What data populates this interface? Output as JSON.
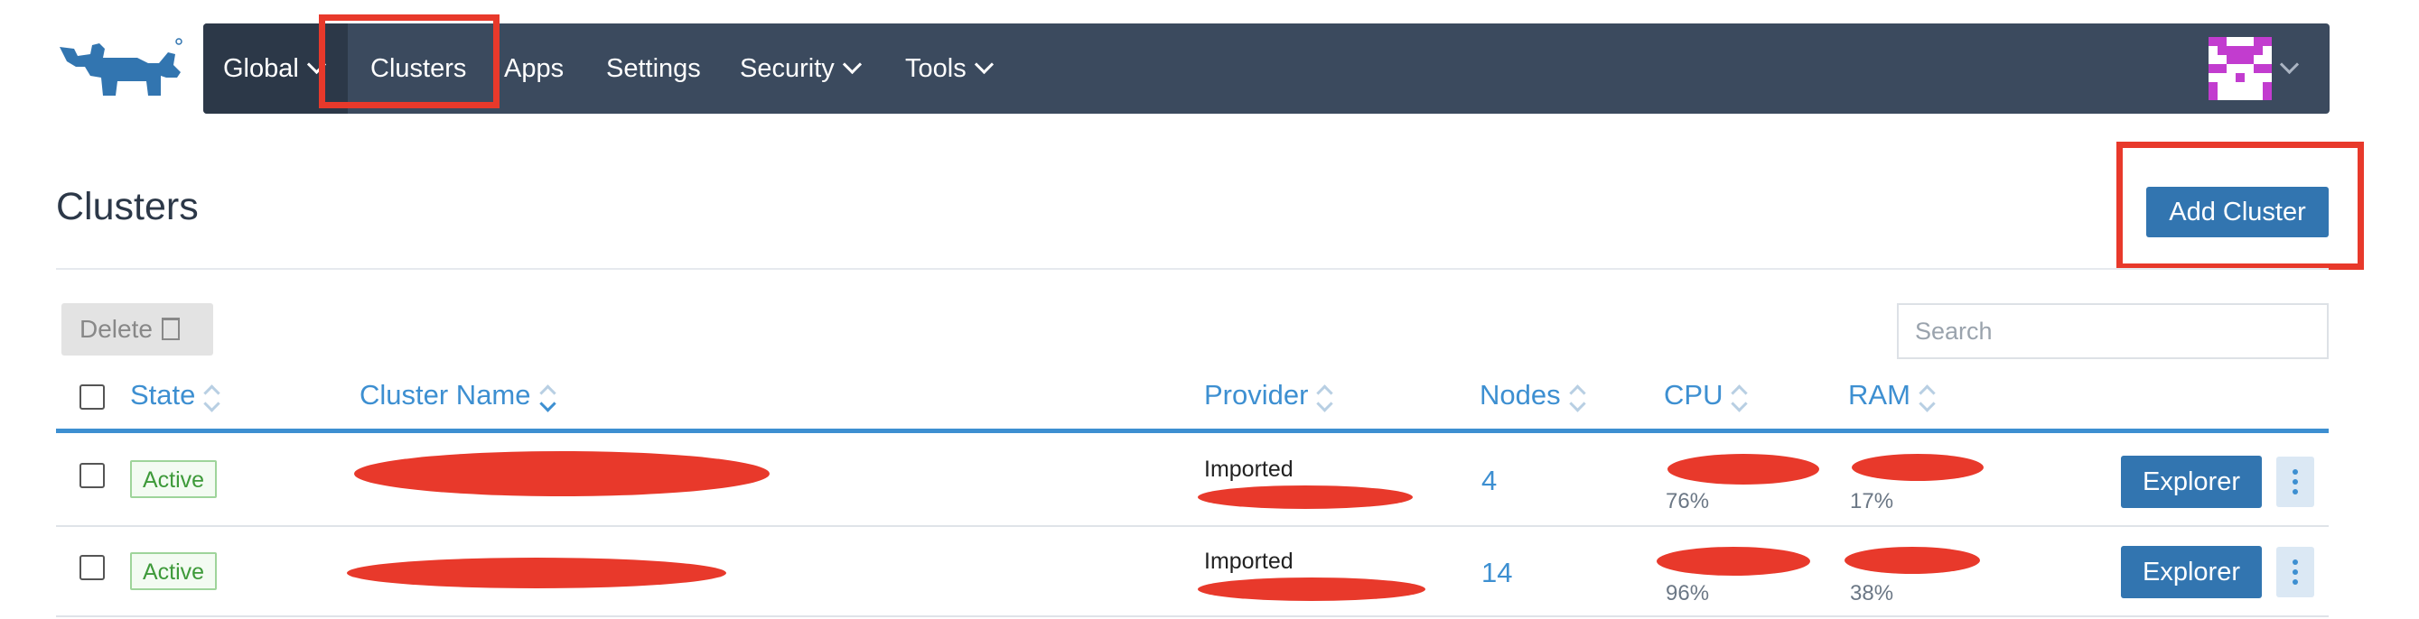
{
  "nav": {
    "items": [
      {
        "label": "Global"
      },
      {
        "label": "Clusters"
      },
      {
        "label": "Apps"
      },
      {
        "label": "Settings"
      },
      {
        "label": "Security"
      },
      {
        "label": "Tools"
      }
    ]
  },
  "page": {
    "title": "Clusters",
    "add_label": "Add Cluster",
    "delete_label": "Delete",
    "search_placeholder": "Search"
  },
  "table": {
    "columns": [
      "State",
      "Cluster Name",
      "Provider",
      "Nodes",
      "CPU",
      "RAM"
    ],
    "rows": [
      {
        "state": "Active",
        "provider": "Imported",
        "nodes": "4",
        "cpu_pct": "76%",
        "ram_pct": "17%",
        "action": "Explorer"
      },
      {
        "state": "Active",
        "provider": "Imported",
        "nodes": "14",
        "cpu_pct": "96%",
        "ram_pct": "38%",
        "action": "Explorer"
      }
    ]
  },
  "colors": {
    "navbar": "#3b4a5e",
    "accent": "#3275b0",
    "link": "#3d8fd1",
    "annotation": "#e8392b",
    "active_badge": "#3e9a3a"
  },
  "icons": {
    "logo": "rancher-cow-logo",
    "trash": "trash-icon",
    "sort": "sort-icon",
    "chevron": "chevron-down-icon",
    "kebab": "kebab-menu-icon"
  }
}
